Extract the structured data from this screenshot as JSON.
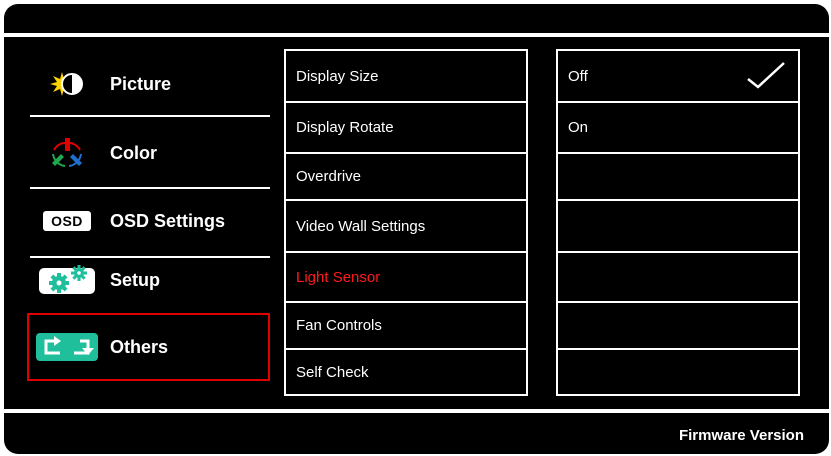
{
  "sidebar": {
    "items": [
      {
        "label": "Picture",
        "icon": "picture-icon"
      },
      {
        "label": "Color",
        "icon": "color-icon"
      },
      {
        "label": "OSD Settings",
        "icon": "osd-icon",
        "badge": "OSD"
      },
      {
        "label": "Setup",
        "icon": "setup-icon"
      },
      {
        "label": "Others",
        "icon": "others-icon"
      }
    ],
    "selected": "Others"
  },
  "menu": {
    "items": [
      {
        "label": "Display Size"
      },
      {
        "label": "Display Rotate"
      },
      {
        "label": "Overdrive"
      },
      {
        "label": "Video Wall Settings"
      },
      {
        "label": "Light Sensor",
        "state": "disabled",
        "color": "#ff1a1a"
      },
      {
        "label": "Fan Controls"
      },
      {
        "label": "Self Check"
      }
    ]
  },
  "options": {
    "items": [
      {
        "label": "Off",
        "checked": true
      },
      {
        "label": "On",
        "checked": false
      },
      {
        "label": ""
      },
      {
        "label": ""
      },
      {
        "label": ""
      },
      {
        "label": ""
      },
      {
        "label": ""
      }
    ]
  },
  "footer": {
    "firmware_label": "Firmware Version"
  },
  "colors": {
    "accent": "#1fbf9c",
    "selection_border": "#e00000",
    "background": "#000000",
    "text": "#ffffff"
  }
}
